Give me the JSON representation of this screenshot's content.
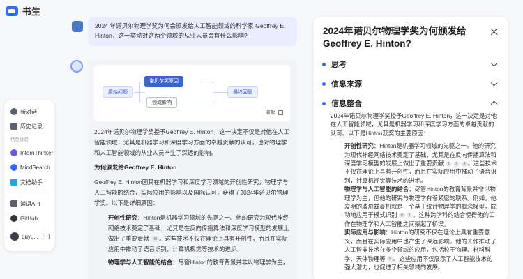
{
  "app": {
    "name": "书生"
  },
  "nav": {
    "new_chat": "新对话",
    "history": "历史记录",
    "section_label": "特色体验",
    "intern_thinker": "InternThinker",
    "mind_search": "MindSearch",
    "doc_assistant": "文档助手",
    "api": "浦语API",
    "github": "GitHub",
    "user": "puyu..."
  },
  "chat": {
    "user_question": "2024 年诺贝尔物理学奖为何会颁发给人工智能领域的科学家 Geoffrey E. Hinton，这一举动对这两个领域的从业人员会有什么影响?",
    "mindmap": {
      "root": "原始问题",
      "mid": "诺贝尔奖原因",
      "sub": "领域影响",
      "end": "最终回复",
      "collapse": "收起"
    },
    "answer_intro": "2024年诺贝尔物理学奖授予Geoffrey E. Hinton，这一决定不仅是对他在人工智能领域，尤其是机器学习和深度学习方面的卓越贡献的认可，也对物理学和人工智能领域的从业人员产生了深远的影响。",
    "heading1": "为何颁发给Geoffrey E. Hinton",
    "para2": "Geoffrey E. Hinton因其在机器学习和深度学习领域的开创性研究，物理学与人工智能的结合，实际应用的影响以及国际认可，获得了2024年诺贝尔物理学奖。以下是详细原因：",
    "point1_title": "开创性研究",
    "point1_text": "：Hinton是机器学习领域的先驱之一。他的研究为现代神经网络技术奠定了基础，尤其是在反向传播算法和深度学习模型的发展上做出了重要贡献",
    "point1_ref": "00",
    "point1_tail": "。这些技术不仅在理论上具有开创性，而且在实际应用中推动了语音识别，计算机视觉等技术的进步。",
    "point2_title": "物理学与人工智能的结合",
    "point2_text": "：尽管Hinton的教育背景并非以物理学为主，"
  },
  "panel": {
    "title": "2024年诺贝尔物理学奖为何颁发给Geoffrey E. Hinton?",
    "sec_think": "思考",
    "sec_source": "信息来源",
    "sec_integrate": "信息整合",
    "intro": "2024年诺贝尔物理学奖授予Geoffrey E. Hinton，这一决定是对他在人工智能领域，尤其是机器学习和深度学习方面的卓越贡献的认可。以下是Hinton获奖的主要原因：",
    "p1_title": "开创性研究",
    "p1_text": "：Hinton是机器学习领域的先驱之一。他的研究为现代神经网络技术奠定了基础，尤其是在反向传播算法和深度学习模型的发展上做出了重要贡献",
    "p1_ref_a": "1",
    "p1_ref_b": "2",
    "p1_ref_c": "4",
    "p1_tail": "。这些技术不仅在理论上具有开创性，而且在实际应用中推动了语音识别，计算机视觉等技术的进步。",
    "p2_title": "物理学与人工智能的结合",
    "p2_text": "：尽管Hinton的教育背景并非以物理学为主，但他的研究与物理学有着紧密的联系。例如，他发明的玻尔兹曼机就是一个基于统计物理学的概念模型，成功地应用于模式识别",
    "p2_ref_a": "0",
    "p2_ref_b": "1",
    "p2_tail": "。这种跨学科的结合使得他的工作在物理学和人工智能之间架起了桥梁。",
    "p3_title": "实际应用与影响",
    "p3_text": "：Hinton的研究不仅在理论上具有重要意义，而且在实际应用中也产生了深远影响。他的工作推动了人工智能技术在多个领域的应用，包括粒子物理、材料科学、天体物理等",
    "p3_ref": "6",
    "p3_tail": "。这些应用不仅展示了人工智能技术的强大潜力，也促进了相关领域的发展。"
  }
}
